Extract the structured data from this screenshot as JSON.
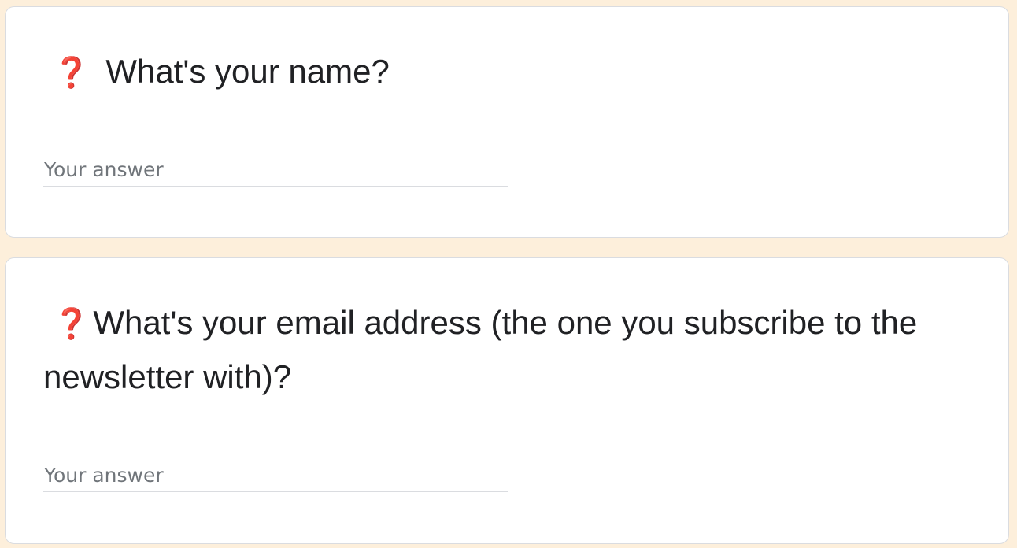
{
  "form": {
    "questions": [
      {
        "required_marker": "❓",
        "title": "What's your name?",
        "answer_placeholder": "Your answer",
        "answer_value": ""
      },
      {
        "required_marker": "❓",
        "title": "What's your email address (the one you subscribe to the newsletter with)?",
        "answer_placeholder": "Your answer",
        "answer_value": ""
      }
    ]
  },
  "colors": {
    "page_background": "#fdefdb",
    "card_background": "#ffffff",
    "card_border": "#dadce0",
    "question_text": "#202124",
    "required_marker": "#e50b0b",
    "placeholder_text": "#70757a",
    "answer_underline": "#dadce0"
  },
  "icons": {
    "required_marker": "red-question-mark-icon"
  }
}
